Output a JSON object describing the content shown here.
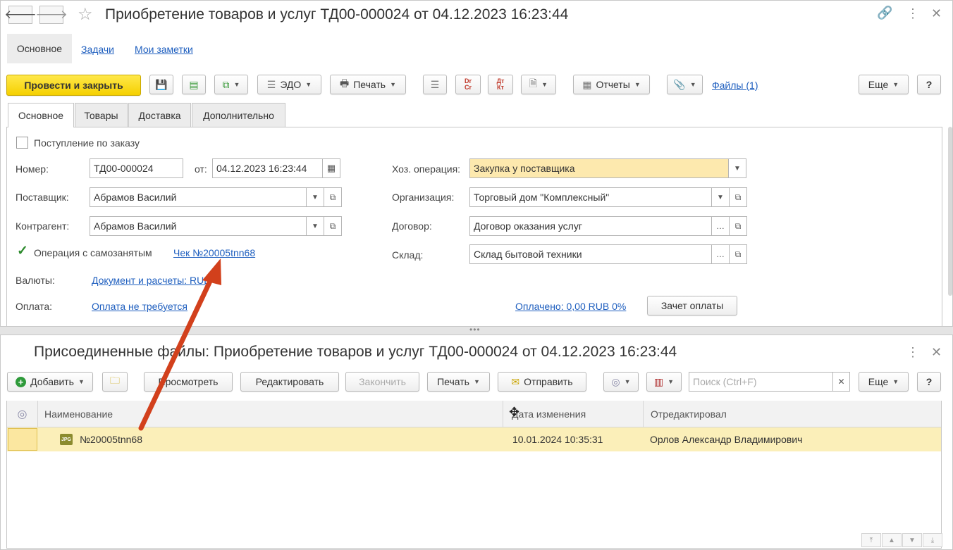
{
  "window": {
    "title": "Приобретение товаров и услуг ТД00-000024 от 04.12.2023 16:23:44"
  },
  "nav_tabs": [
    "Основное",
    "Задачи",
    "Мои заметки"
  ],
  "toolbar": {
    "post_close": "Провести и закрыть",
    "edo": "ЭДО",
    "print": "Печать",
    "dt_cr": "Dr Cr",
    "dt_kt": "Дт Кт",
    "reports": "Отчеты",
    "files": "Файлы (1)",
    "more": "Еще",
    "help": "?"
  },
  "form_tabs": [
    "Основное",
    "Товары",
    "Доставка",
    "Дополнительно"
  ],
  "form": {
    "order_receipt_label": "Поступление по заказу",
    "order_receipt_checked": false,
    "number_label": "Номер:",
    "number": "ТД00-000024",
    "date_label": "от:",
    "date": "04.12.2023 16:23:44",
    "operation_label": "Хоз. операция:",
    "operation": "Закупка у поставщика",
    "supplier_label": "Поставщик:",
    "supplier": "Абрамов Василий",
    "organization_label": "Организация:",
    "organization": "Торговый дом \"Комплексный\"",
    "counterparty_label": "Контрагент:",
    "counterparty": "Абрамов Василий",
    "contract_label": "Договор:",
    "contract": "Договор оказания услуг",
    "selfemployed_label": "Операция с самозанятым",
    "selfemployed_checked": true,
    "receipt_link": "Чек №20005tnn68",
    "warehouse_label": "Склад:",
    "warehouse": "Склад бытовой техники",
    "currency_label": "Валюты:",
    "currency_link": "Документ и расчеты: RUB",
    "payment_label": "Оплата:",
    "payment_link": "Оплата не требуется",
    "paid_link": "Оплачено: 0,00 RUB 0%",
    "offset_button": "Зачет оплаты"
  },
  "attached": {
    "title": "Присоединенные файлы: Приобретение товаров и услуг ТД00-000024 от 04.12.2023 16:23:44",
    "toolbar": {
      "add": "Добавить",
      "view": "Просмотреть",
      "edit": "Редактировать",
      "finish": "Закончить",
      "print": "Печать",
      "send": "Отправить",
      "search_placeholder": "Поиск (Ctrl+F)",
      "more": "Еще",
      "help": "?"
    },
    "columns": [
      "Наименование",
      "Дата изменения",
      "Отредактировал"
    ],
    "rows": [
      {
        "name": "№20005tnn68",
        "modified": "10.01.2024 10:35:31",
        "editor": "Орлов Александр Владимирович"
      }
    ]
  },
  "colors": {
    "accent_yellow": "#f5d000",
    "link": "#1f5fbf",
    "selected_row": "#fbefb9",
    "annotation_arrow": "#d2401c"
  }
}
